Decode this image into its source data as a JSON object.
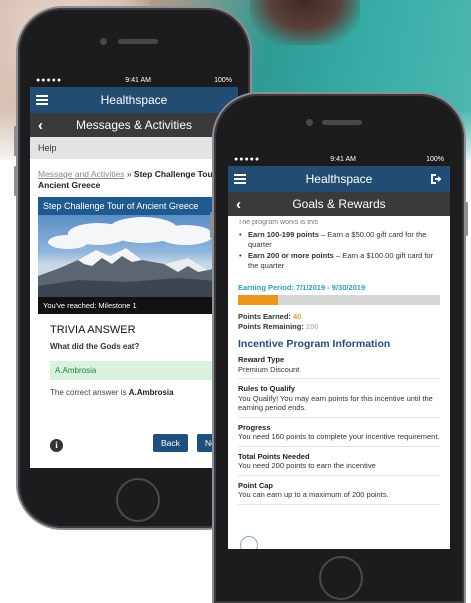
{
  "left_phone": {
    "status": {
      "signal": "●●●●● ",
      "time": "9:41 AM",
      "battery": "100%"
    },
    "app_title": "Healthspace",
    "screen_title": "Messages & Activities",
    "help_label": "Help",
    "breadcrumb": {
      "link": "Message and Activities",
      "separator": " » ",
      "current": "Step Challenge Tour of Ancient Greece"
    },
    "card_title": "Step Challenge Tour of Ancient Greece",
    "milestone_text": "You've reached: Milestone 1",
    "trivia_title": "TRIVIA ANSWER",
    "trivia_question": "What did the Gods eat?",
    "answer_option": "A.Ambrosia",
    "answer_note_prefix": "The correct answer is ",
    "answer_note_value": "A.Ambrosia",
    "back_button": "Back",
    "next_button": "Ne"
  },
  "right_phone": {
    "status": {
      "signal": "●●●●● ",
      "time": "9:41 AM",
      "battery": "100%"
    },
    "app_title": "Healthspace",
    "screen_title": "Goals & Rewards",
    "cut_line": "The program works is this",
    "bullets": [
      {
        "strong": "Earn 100-199 points",
        "text": " – Earn a $50.00 gift card for the quarter"
      },
      {
        "strong": "Earn 200 or more points",
        "text": " – Earn a $100.00 gift card for the quarter"
      }
    ],
    "earning_period": "Earning Period: 7/1/2019 - 9/30/2019",
    "progress_fraction": 0.2,
    "points_earned_label": "Points Earned: ",
    "points_earned_value": "40",
    "points_remaining_label": "Points Remaining: ",
    "points_remaining_value": "200",
    "section_title": "Incentive Program Information",
    "details": [
      {
        "label": "Reward Type",
        "value": "Premium Discount"
      },
      {
        "label": "Rules to Qualify",
        "value": "You Qualify! You may earn points for this incentive until the earning period ends."
      },
      {
        "label": "Progress",
        "value": "You need 160 points to complete your incentive requirement."
      },
      {
        "label": "Total Points Needed",
        "value": "You need 200 points to earn the incentive"
      },
      {
        "label": "Point Cap",
        "value": "You can earn up to a maximum of 200 points."
      }
    ]
  },
  "colors": {
    "app_bar": "#234c73",
    "sub_bar": "#3a3a3c",
    "progress": "#e8961f",
    "period_text": "#2f9cb6",
    "section_title": "#1f4d78",
    "answer_bg": "#d8f2de"
  }
}
